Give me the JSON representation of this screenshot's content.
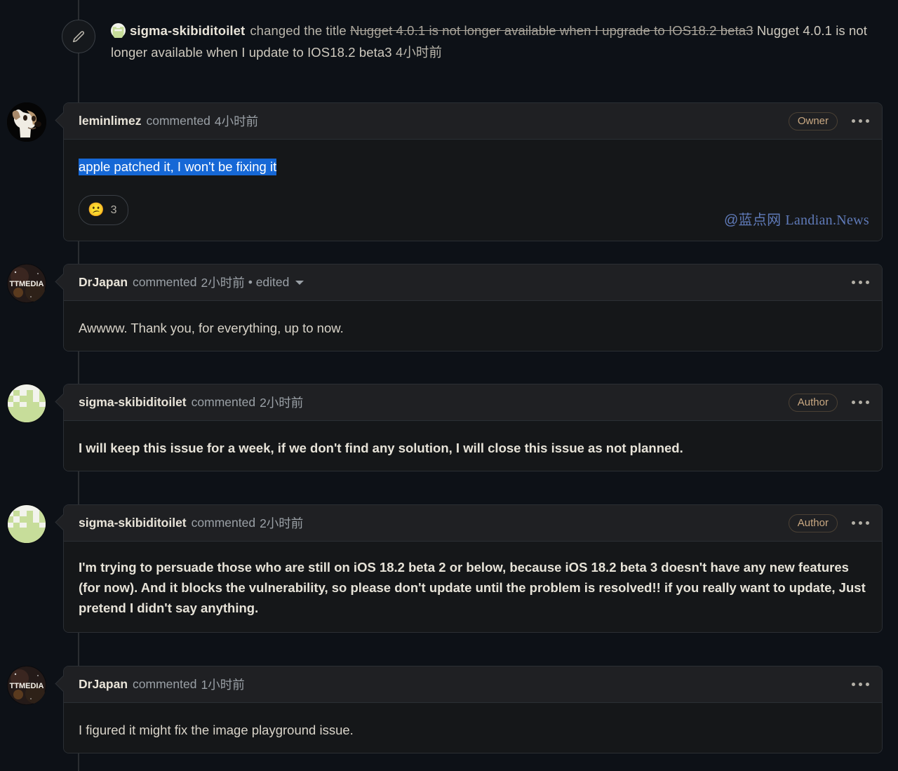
{
  "theme": {
    "page_bg": "#0d1117",
    "bubble_bg": "#151719",
    "header_bg": "#1f2023",
    "border": "#2b2f34",
    "rail": "#2a2d31",
    "badge_text": "#c9a882",
    "selection_bg": "#1668d6",
    "watermark_color": "#5f7ab8"
  },
  "timeline_event": {
    "icon": "pencil-icon",
    "actor": "sigma-skibiditoilet",
    "action": "changed the title",
    "old_title": "Nugget 4.0.1 is not longer available when I upgrade to IOS18.2 beta3",
    "new_title": "Nugget 4.0.1 is not longer available when I update to IOS18.2 beta3",
    "time": "4小时前"
  },
  "comments": [
    {
      "id": "comment-leminlimez",
      "author": "leminlimez",
      "avatar": "dog-avatar",
      "action": "commented",
      "time": "4小时前",
      "edited": null,
      "badge": "Owner",
      "menu_icon": "kebab-menu-icon",
      "body": "apple patched it, I won't be fixing it",
      "selected": true,
      "bold_body": false,
      "reactions": [
        {
          "emoji": "😕",
          "name": "confused-reaction",
          "count": "3"
        }
      ],
      "watermark": {
        "cn": "@蓝点网",
        "latin": "Landian.News"
      }
    },
    {
      "id": "comment-drjapan-1",
      "author": "DrJapan",
      "avatar": "ttmedia-avatar",
      "action": "commented",
      "time": "2小时前",
      "edited": "• edited",
      "badge": null,
      "menu_icon": "kebab-menu-icon",
      "body": "Awwww. Thank you, for everything, up to now.",
      "selected": false,
      "bold_body": false,
      "reactions": [],
      "watermark": null
    },
    {
      "id": "comment-sigma-1",
      "author": "sigma-skibiditoilet",
      "avatar": "pixel-green-avatar",
      "action": "commented",
      "time": "2小时前",
      "edited": null,
      "badge": "Author",
      "menu_icon": "kebab-menu-icon",
      "body": "I will keep this issue for a week, if we don't find any solution, I will close this issue as not planned.",
      "selected": false,
      "bold_body": true,
      "reactions": [],
      "watermark": null
    },
    {
      "id": "comment-sigma-2",
      "author": "sigma-skibiditoilet",
      "avatar": "pixel-green-avatar",
      "action": "commented",
      "time": "2小时前",
      "edited": null,
      "badge": "Author",
      "menu_icon": "kebab-menu-icon",
      "body": "I'm trying to persuade those who are still on iOS 18.2 beta 2 or below, because iOS 18.2 beta 3 doesn't have any new features (for now). And it blocks the vulnerability, so please don't update until the problem is resolved!! if you really want to update, Just pretend I didn't say anything.",
      "selected": false,
      "bold_body": true,
      "reactions": [],
      "watermark": null
    },
    {
      "id": "comment-drjapan-2",
      "author": "DrJapan",
      "avatar": "ttmedia-avatar",
      "action": "commented",
      "time": "1小时前",
      "edited": null,
      "badge": null,
      "menu_icon": "kebab-menu-icon",
      "body": "I figured it might fix the image playground issue.",
      "selected": false,
      "bold_body": false,
      "reactions": [],
      "watermark": null
    }
  ]
}
